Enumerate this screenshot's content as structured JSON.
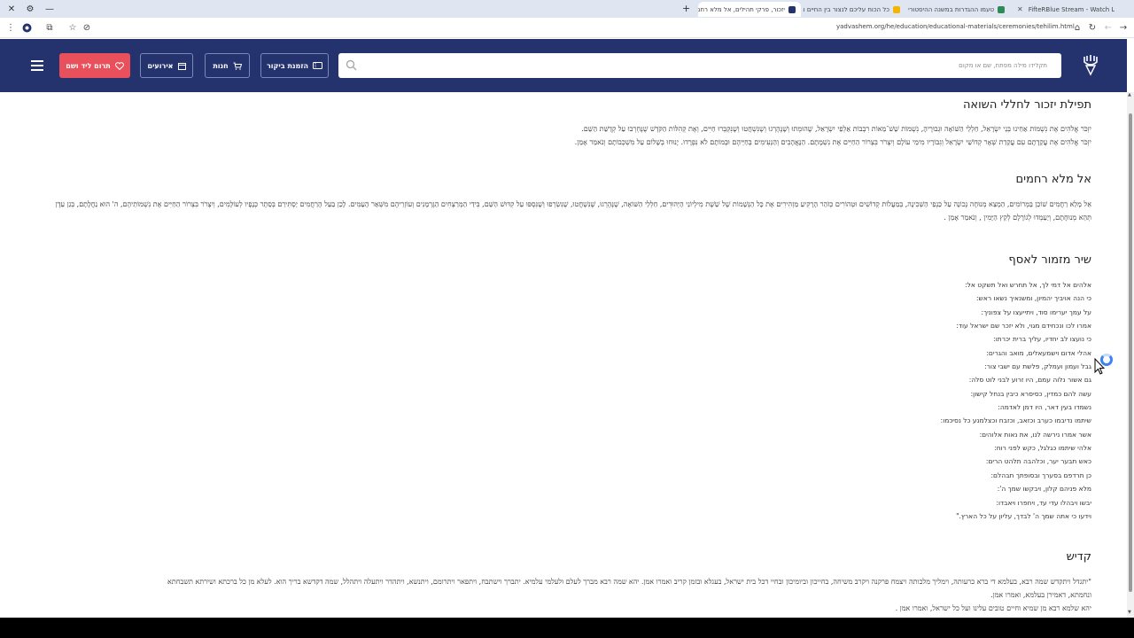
{
  "browser": {
    "window_controls": [
      "✕",
      "⚙",
      "—"
    ],
    "tabs": [
      {
        "title": "יזכור, פרקי תהילים, אל מלא רחמ",
        "active": true,
        "favicon_color": "#24336e"
      },
      {
        "title": "כל הכוח עליכם לנצור בין החיים וב",
        "active": false,
        "favicon_color": "#f5b400"
      },
      {
        "title": "טעמו ההגדרות במשנה ההיסטורי",
        "active": false,
        "favicon_color": "#2e8b57"
      },
      {
        "title": "FifteRBlue Stream - Watch Live",
        "active": false,
        "favicon_color": "#33cc33"
      }
    ],
    "new_tab": "+",
    "url": "yadvashem.org/he/education/educational-materials/ceremonies/tehilim.html"
  },
  "header": {
    "donate_label": "תרום ליד ושם",
    "events_label": "אירועים",
    "shop_label": "חנות",
    "visit_label": "הזמנת ביקור",
    "search_placeholder": "תקלידו מילה מפתח, שם או מקום",
    "colors": {
      "header_bg": "#24336e",
      "donate_bg": "#e8505b"
    }
  },
  "content": {
    "yizkor": {
      "title": "תפילת יזכור לחללי השואה",
      "lines": [
        "יִזְכֹּר אֱלֹהִים אֶת נִשְׁמוֹת אַחֵינוּ בְּנֵי יִשְׂרָאֵל, חַלְלֵי הַשּׁוֹאָה וּגְבוּרֶיהָ, נִשְׁמוֹת שֵׁשׁ־מֵאוֹת רִבְבוֹת אַלְפֵי יִשְׂרָאֵל, שֶׁהוּמְתוּ וְשֶׁנֶּהֶרְגוּ וְשֶׁנִּשְׁחֲטוּ וְשֶׁנִּקְבְּרוּ חַיִּים, וְאֶת קְהִלּוֹת הַקֹּדֶשׁ שֶׁנֶּחְרְבוּ עַל קְדֻשַּׁת הַשֵּׁם.",
        "יִזְכֹּר אֱלֹהִים אֶת עֲקֵדָתָם עִם עֲקֵדַת שְׁאָר קְדוֹשֵׁי יִשְׂרָאֵל וְגִבּוֹרָיו מִימֵי עוֹלָם וְיִצְרֹר בִּצְרוֹר הַחַיִּים אֶת נִשְׁמָתָם. הַנֶּאֱהָבִים וְהַנְּעִימִים בְּחַיֵּיהֶם וּבְמוֹתָם לֹא נִפְרָדוּ. יָנוּחוּ בְשָׁלוֹם עַל מִשְׁכְּבוֹתָם וְנֹאמַר אָמֵן."
      ]
    },
    "el_male": {
      "title": "אל מלא רחמים",
      "text": "אֵל מָלֵא רַחֲמִים שׁוֹכֵן בַּמְּרוֹמִים, הַמְצֵא מְנוּחָה נְכוֹנָה עַל כַּנְפֵי הַשְּׁכִינָה, בְּמַעֲלוֹת קְדוֹשִׁים וּטְהוֹרִים כְּזֹהַר הָרָקִיעַ מַזְהִירִים אֶת כָּל הַנְּשָׁמוֹת שֶׁל שֵׁשֶׁת מִילְיוֹנֵי הַיְּהוּדִים, חַלְלֵי הַשּׁוֹאָה, שֶׁנֶּהֶרְגוּ, שֶׁנִּשְׁחֲטוּ, שֶׁנִּשְׂרְפוּ וְשֶׁנִּסְפּוּ עַל קִדּוּשׁ הַשֵּׁם, בִּידֵי הַמְּרַצְּחִים הַגֶּרְמָנִים וְעוֹזְרֵיהֶם מִשְּׁאַר הָעַמִּים. לָכֵן בַּעַל הָרַחֲמִים יַסְתִּירֵם בְּסֵתֶר כְּנָפָיו לְעוֹלָמִים, וְיִצְרֹר בִּצְרוֹר הַחַיִּים אֶת נִשְׁמוֹתֵיהֶם, ה' הוּא נַחֲלָתָם, בְּגַן עֵדֶן תְּהֵא מְנוּחָתָם, וְיַעַמְדוּ לְגוֹרָלָם לְקֵץ הַיָּמִין , וְנֹאמַר אָמֵן ."
    },
    "psalm": {
      "title": "שיר מזמור לאסף",
      "lines": [
        "אלהים אל דמי לך, אל תחרש ואל תשקט אל:",
        "כי הנה אויביך יהמיון, ומשנאיך נשאו ראש:",
        "על עמך יערימו סוד, ויתייעצו על צפוניך:",
        "אמרו לכו ונכחידם מגוי, ולא יזכר שם ישראל עוד:",
        "כי נועצו לב יחדיו, עליך ברית יכרתו:",
        "אהלי אדום וישמעאלים, מואב והגרים:",
        "גבל ועמון ועמלק, פלשת עם ישבי צור:",
        "גם אשור נלוה עמם, היו זרוע לבני לוט סלה:",
        "עשה להם כמדין, כסיסרא כיבין בנחל קישון:",
        "נשמדו בעין דאר, היו דמן לאדמה:",
        "שיתמו נדיבמו כערב וכזאב, וכזבח וכצלמנע כל נסיכמו:",
        "אשר אמרו נירשה לנו, את נאות אלוהים:",
        "אלהי שיתמו כגלגל, כקש לפני רוח:",
        "כאש תבער יער, וכלהבה תלהט הרים:",
        "כן תרדפם בסערך ובסופתך תבהלם:",
        "מלא פניהם קלון, ויבקשו שמך ה':",
        "יבשו ויבהלו עדי עד, ויחפרו ויאבדו:",
        "וידעו כי אתה שמך ה' לבדך, עליון על כל הארץ.\""
      ]
    },
    "kaddish": {
      "title": "קדיש",
      "lines": [
        "\"יתגדל ויתקדש שמה רבא, בעלמא די ברא כרעותה, וימליך מלכותה ויצמח פרקנה ויקרב משיחה, בחייכון וביומיכון ובחיי דכל בית ישראל, בעגלא ובזמן קריב ואמרו אמן. יהא שמה רבא מברך לעלם ולעלמי עלמיא. יתברך וישתבח, ויתפאר ויתרומם, ויתנשא, ויתהדר ויתעלה ויתהלל, שמה דקדשא בריך הוא. לעלא מן כל ברכתא ושירתא תשבחתא",
        "ונחמתא, דאמירן בעלמא, ואמרו אמן.",
        "יהא שלמא רבא מן שמיא וחיים טובים עלינו ועל כל ישראל, ואמרו אמן ."
      ]
    }
  }
}
